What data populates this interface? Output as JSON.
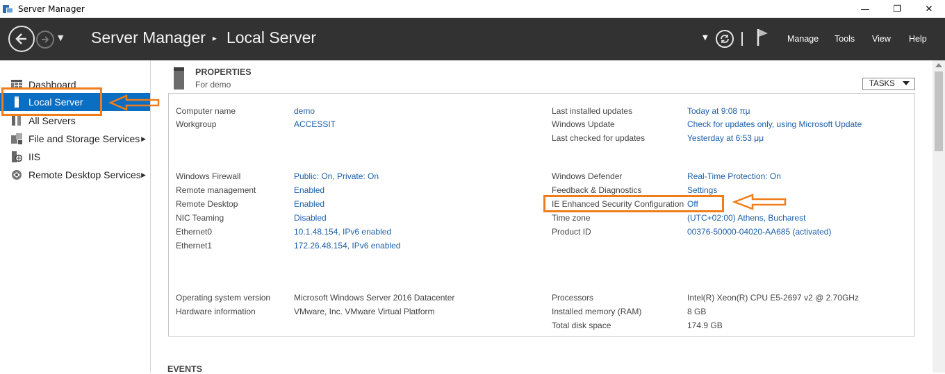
{
  "window": {
    "title": "Server Manager",
    "controls": {
      "minimize": "—",
      "maximize": "❐",
      "close": "✕"
    }
  },
  "header": {
    "breadcrumb": [
      "Server Manager",
      "Local Server"
    ],
    "menu": [
      "Manage",
      "Tools",
      "View",
      "Help"
    ]
  },
  "sidebar": {
    "items": [
      {
        "label": "Dashboard",
        "icon": "dashboard-icon",
        "chevron": false,
        "active": false
      },
      {
        "label": "Local Server",
        "icon": "local-server-icon",
        "chevron": false,
        "active": true
      },
      {
        "label": "All Servers",
        "icon": "all-servers-icon",
        "chevron": false,
        "active": false
      },
      {
        "label": "File and Storage Services",
        "icon": "file-storage-icon",
        "chevron": true,
        "active": false
      },
      {
        "label": "IIS",
        "icon": "iis-icon",
        "chevron": false,
        "active": false
      },
      {
        "label": "Remote Desktop Services",
        "icon": "remote-desktop-icon",
        "chevron": true,
        "active": false
      }
    ]
  },
  "properties": {
    "title": "PROPERTIES",
    "subtitle": "For demo",
    "tasks_label": "TASKS",
    "left": [
      {
        "label": "Computer name",
        "value": "demo",
        "link": true
      },
      {
        "label": "Workgroup",
        "value": "ACCESSIT",
        "link": true
      },
      {
        "label": "Windows Firewall",
        "value": "Public: On, Private: On",
        "link": true
      },
      {
        "label": "Remote management",
        "value": "Enabled",
        "link": true
      },
      {
        "label": "Remote Desktop",
        "value": "Enabled",
        "link": true
      },
      {
        "label": "NIC Teaming",
        "value": "Disabled",
        "link": true
      },
      {
        "label": "Ethernet0",
        "value": "10.1.48.154, IPv6 enabled",
        "link": true
      },
      {
        "label": "Ethernet1",
        "value": "172.26.48.154, IPv6 enabled",
        "link": true
      },
      {
        "label": "Operating system version",
        "value": "Microsoft Windows Server 2016 Datacenter",
        "link": false
      },
      {
        "label": "Hardware information",
        "value": "VMware, Inc. VMware Virtual Platform",
        "link": false
      }
    ],
    "right": [
      {
        "label": "Last installed updates",
        "value": "Today at 9:08 πμ",
        "link": true
      },
      {
        "label": "Windows Update",
        "value": "Check for updates only, using Microsoft Update",
        "link": true
      },
      {
        "label": "Last checked for updates",
        "value": "Yesterday at 6:53 μμ",
        "link": true
      },
      {
        "label": "Windows Defender",
        "value": "Real-Time Protection: On",
        "link": true
      },
      {
        "label": "Feedback & Diagnostics",
        "value": "Settings",
        "link": true
      },
      {
        "label": "IE Enhanced Security Configuration",
        "value": "Off",
        "link": true
      },
      {
        "label": "Time zone",
        "value": "(UTC+02:00) Athens, Bucharest",
        "link": true
      },
      {
        "label": "Product ID",
        "value": "00376-50000-04020-AA685 (activated)",
        "link": true
      },
      {
        "label": "Processors",
        "value": "Intel(R) Xeon(R) CPU E5-2697 v2 @ 2.70GHz",
        "link": false
      },
      {
        "label": "Installed memory (RAM)",
        "value": "8 GB",
        "link": false
      },
      {
        "label": "Total disk space",
        "value": "174.9 GB",
        "link": false
      }
    ]
  },
  "events": {
    "title": "EVENTS"
  },
  "colors": {
    "header_bg": "#323232",
    "active_bg": "#0a6fc2",
    "link": "#1c5fa8",
    "annotation": "#f07d1a"
  }
}
